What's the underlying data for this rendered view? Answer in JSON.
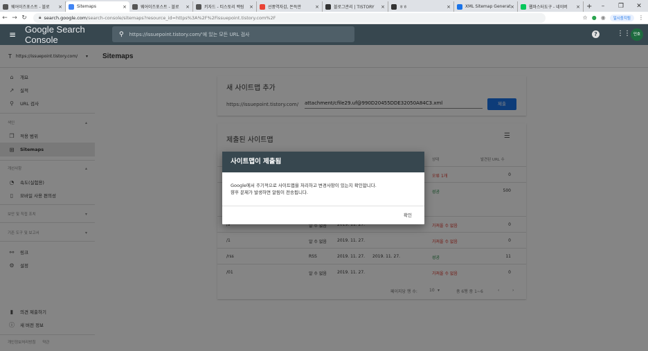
{
  "browser": {
    "tabs": [
      {
        "label": "웨어이즈포스트 - 블로",
        "icon": "globe-icon",
        "color": "#555555",
        "active": false
      },
      {
        "label": "Sitemaps",
        "icon": "search-console-icon",
        "color": "#4285f4",
        "active": true
      },
      {
        "label": "웨어이즈포스트 - 블로",
        "icon": "globe-icon",
        "color": "#555555",
        "active": false
      },
      {
        "label": "키자드 - 티스토리 백링",
        "icon": "wand-icon",
        "color": "#555555",
        "active": false
      },
      {
        "label": "선풍역자감, 돈득만",
        "icon": "google-icon",
        "color": "#ea4335",
        "active": false
      },
      {
        "label": "블로그관리 | TISTORY",
        "icon": "tistory-icon",
        "color": "#333333",
        "active": false
      },
      {
        "label": "ㅎㅎ",
        "icon": "tistory-icon",
        "color": "#333333",
        "active": false
      },
      {
        "label": "XML Sitemap Generat",
        "icon": "chart-icon",
        "color": "#1a73e8",
        "active": false
      },
      {
        "label": "웹마스터도구 - 네이버",
        "icon": "naver-icon",
        "color": "#03c75a",
        "active": false
      }
    ],
    "url_host": "search.google.com",
    "url_rest": "/search-console/sitemaps?resource_id=https%3A%2F%2Fissuepoint.tistory.com%2F",
    "pause_label": "일시중지됨",
    "new_tab": "+"
  },
  "header": {
    "title": "Google Search Console",
    "search_placeholder": "https://issuepoint.tistory.com/'에 있는 모든 URL 검사",
    "avatar_text": "민호"
  },
  "sidebar": {
    "property": "https://issuepoint.tistory.com/",
    "items": [
      {
        "label": "개요",
        "icon": "home-icon"
      },
      {
        "label": "실적",
        "icon": "trend-icon"
      },
      {
        "label": "URL 검사",
        "icon": "search-icon"
      }
    ],
    "index_section": "색인",
    "index_items": [
      {
        "label": "적용 범위",
        "icon": "copy-icon"
      },
      {
        "label": "Sitemaps",
        "icon": "sitemap-icon"
      }
    ],
    "enhance_section": "개선사항",
    "enhance_items": [
      {
        "label": "속도(실험용)",
        "icon": "speed-icon"
      },
      {
        "label": "모바일 사용 편의성",
        "icon": "mobile-icon"
      }
    ],
    "security_section": "보안 및 직접 조치",
    "legacy_section": "기존 도구 및 보고서",
    "bottom_items": [
      {
        "label": "링크",
        "icon": "links-icon"
      },
      {
        "label": "설정",
        "icon": "gear-icon"
      }
    ],
    "extra_items": [
      {
        "label": "의견 제출하기",
        "icon": "feedback-icon"
      },
      {
        "label": "새 버전 정보",
        "icon": "info-icon"
      }
    ],
    "footer_privacy": "개인정보처리방침",
    "footer_terms": "약관"
  },
  "page": {
    "title": "Sitemaps"
  },
  "add_card": {
    "title": "새 사이트맵 추가",
    "prefix": "https://issuepoint.tistory.com/",
    "input_value": "attachment/cfile29.uf@990D20455DDE32050A84C3.xml",
    "submit": "제출"
  },
  "submitted_card": {
    "title": "제출된 사이트맵",
    "col_status": "상태",
    "col_urls": "발견된 URL 수",
    "rows": [
      {
        "sitemap": "",
        "type": "",
        "submitted": "",
        "read": "",
        "status": "오류 1개",
        "status_color": "red",
        "urls": "0"
      },
      {
        "sitemap": "",
        "type": "",
        "submitted": "",
        "read": "",
        "status": "성공",
        "status_color": "green",
        "urls": "500"
      },
      {
        "sitemap": "/s",
        "type": "알 수 없음",
        "submitted": "2019. 11. 27.",
        "read": "",
        "status": "가져올 수 없음",
        "status_color": "red",
        "urls": "0"
      },
      {
        "sitemap": "/1",
        "type": "알 수 없음",
        "submitted": "2019. 11. 27.",
        "read": "",
        "status": "가져올 수 없음",
        "status_color": "red",
        "urls": "0"
      },
      {
        "sitemap": "/rss",
        "type": "RSS",
        "submitted": "2019. 11. 27.",
        "read": "2019. 11. 27.",
        "status": "성공",
        "status_color": "green",
        "urls": "11"
      },
      {
        "sitemap": "/01",
        "type": "알 수 없음",
        "submitted": "2019. 11. 27.",
        "read": "",
        "status": "가져올 수 없음",
        "status_color": "red",
        "urls": "0"
      }
    ],
    "rows_per_page_label": "페이지당 행 수:",
    "rows_per_page": "10",
    "range": "총 6행 중 1~6"
  },
  "dialog": {
    "title": "사이트맵이 제출됨",
    "line1": "Google에서 주기적으로 사이트맵을 처리하고 변경사항이 있는지 확인합니다.",
    "line2": "향후 문제가 발생하면 알림이 전송됩니다.",
    "ok": "확인"
  },
  "colors": {
    "header_bg": "#37474f",
    "accent": "#1a73e8",
    "error": "#d93025",
    "success": "#188038"
  }
}
